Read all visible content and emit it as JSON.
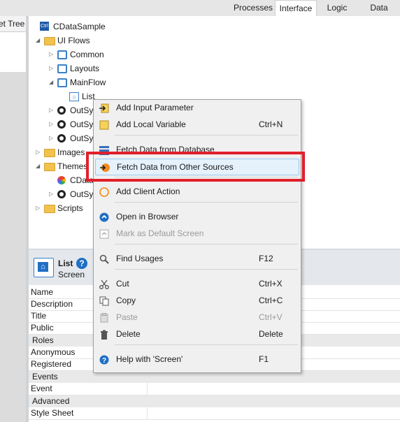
{
  "top_tabs": [
    {
      "label": "Processes",
      "active": false
    },
    {
      "label": "Interface",
      "active": true
    },
    {
      "label": "Logic",
      "active": false
    },
    {
      "label": "Data",
      "active": false
    }
  ],
  "left_panel": {
    "tab_label": "et Tree"
  },
  "tree": {
    "root": "CDataSample",
    "ui_flows": "UI Flows",
    "common": "Common",
    "layouts": "Layouts",
    "mainflow": "MainFlow",
    "list": "List",
    "outsys1": "OutSy",
    "outsys2": "OutSy",
    "outsys3": "OutSy",
    "images": "Images",
    "themes": "Themes",
    "cdata_theme": "CData",
    "outsys4": "OutSy",
    "scripts": "Scripts"
  },
  "props": {
    "title": "List",
    "subtitle": "Screen",
    "rows": [
      {
        "type": "row",
        "name": "Name"
      },
      {
        "type": "row",
        "name": "Description"
      },
      {
        "type": "row",
        "name": "Title"
      },
      {
        "type": "row",
        "name": "Public"
      },
      {
        "type": "section",
        "name": "Roles"
      },
      {
        "type": "row",
        "name": "Anonymous"
      },
      {
        "type": "row",
        "name": "Registered"
      },
      {
        "type": "section",
        "name": "Events"
      },
      {
        "type": "row",
        "name": "Event"
      },
      {
        "type": "section",
        "name": "Advanced"
      },
      {
        "type": "row",
        "name": "Style Sheet"
      }
    ]
  },
  "menu": {
    "items": [
      {
        "label": "Add Input Parameter",
        "shortcut": "",
        "icon": "input-parameter-icon"
      },
      {
        "label": "Add Local Variable",
        "shortcut": "Ctrl+N",
        "icon": "local-variable-icon"
      },
      {
        "label": "Fetch Data from Database",
        "shortcut": "",
        "icon": "database-icon"
      },
      {
        "label": "Fetch Data from Other Sources",
        "shortcut": "",
        "icon": "other-sources-icon",
        "highlighted": true
      },
      {
        "label": "Add Client Action",
        "shortcut": "",
        "icon": "client-action-icon"
      },
      {
        "label": "Open in Browser",
        "shortcut": "",
        "icon": "browser-icon"
      },
      {
        "label": "Mark as Default Screen",
        "shortcut": "",
        "icon": "default-screen-icon",
        "disabled": true
      },
      {
        "label": "Find Usages",
        "shortcut": "F12",
        "icon": "search-icon"
      },
      {
        "label": "Cut",
        "shortcut": "Ctrl+X",
        "icon": "scissors-icon"
      },
      {
        "label": "Copy",
        "shortcut": "Ctrl+C",
        "icon": "copy-icon"
      },
      {
        "label": "Paste",
        "shortcut": "Ctrl+V",
        "icon": "paste-icon",
        "disabled": true
      },
      {
        "label": "Delete",
        "shortcut": "Delete",
        "icon": "trash-icon"
      },
      {
        "label": "Help with 'Screen'",
        "shortcut": "F1",
        "icon": "help-icon"
      }
    ]
  },
  "colors": {
    "highlight_box": "#e0202a",
    "accent_blue": "#1f6fc4",
    "folder_yellow": "#f2c24f"
  }
}
